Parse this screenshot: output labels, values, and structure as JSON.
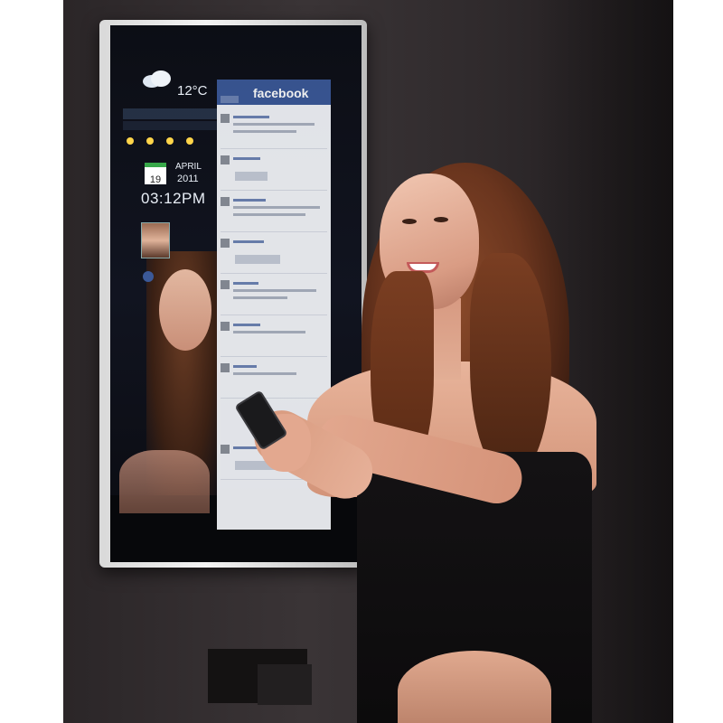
{
  "scene": {
    "description_colors": {
      "wall": "#332e30",
      "mirror_frame": "#e6e6e6",
      "facebook_blue": "#3b5998",
      "dress": "#121012",
      "hair": "#6a351e"
    }
  },
  "mirror": {
    "weather": {
      "temperature": "12°C",
      "icon": "cloud-icon"
    },
    "calendar": {
      "day": "19",
      "month": "APRIL",
      "year": "2011"
    },
    "clock": {
      "time": "03:12PM"
    },
    "facebook": {
      "logo": "facebook",
      "posts_visible": 8
    }
  }
}
